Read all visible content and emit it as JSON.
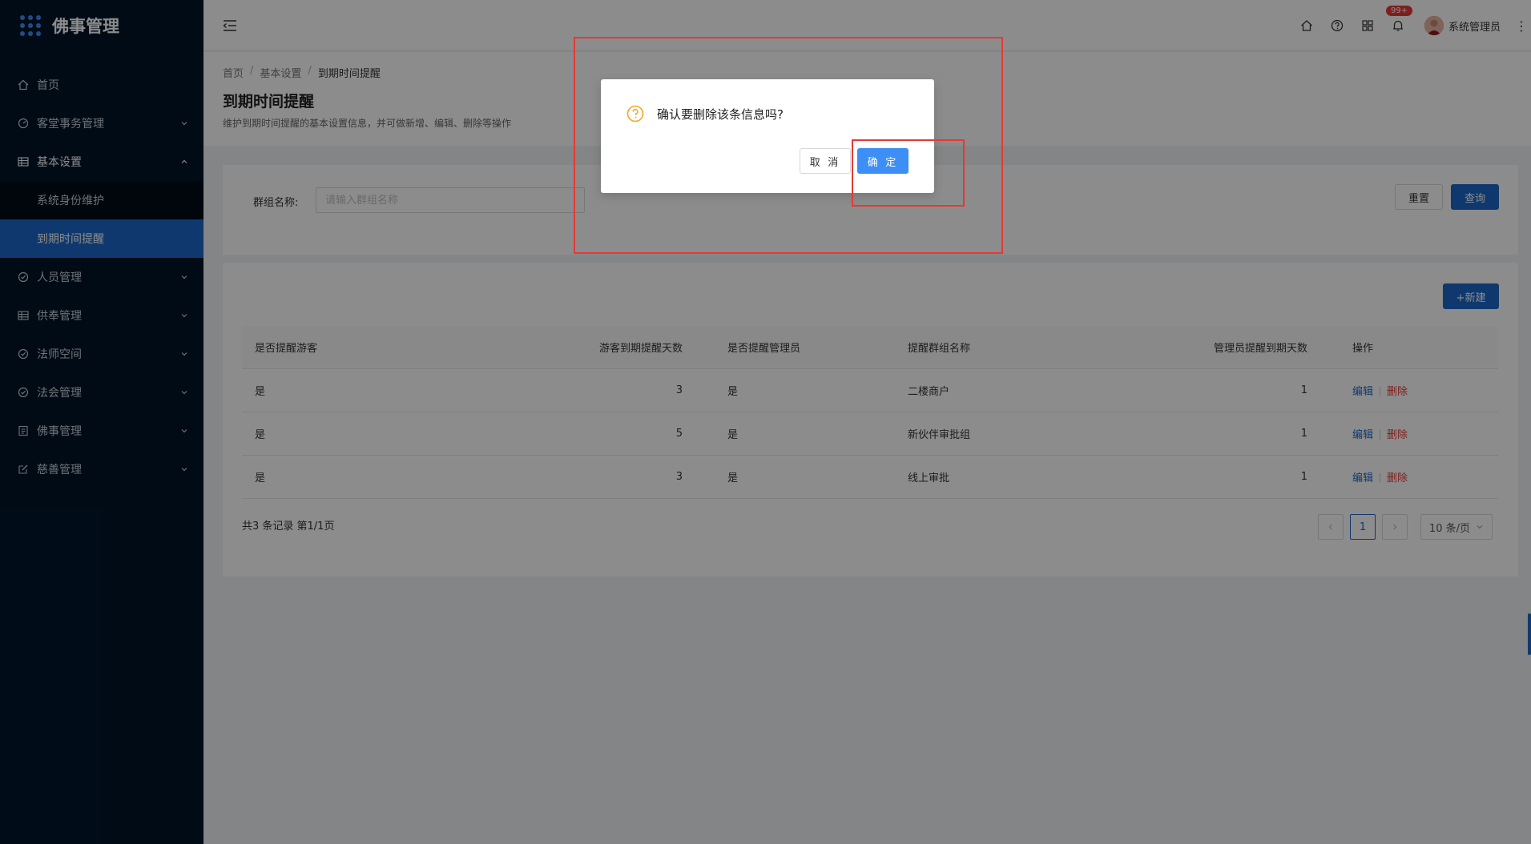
{
  "app": {
    "title": "佛事管理"
  },
  "sidebar": {
    "items": [
      {
        "label": "首页",
        "icon": "home-icon",
        "has_arrow": false
      },
      {
        "label": "客堂事务管理",
        "icon": "dashboard-icon",
        "has_arrow": true
      },
      {
        "label": "基本设置",
        "icon": "table-icon",
        "has_arrow": true,
        "expanded": true,
        "children": [
          {
            "label": "系统身份维护"
          },
          {
            "label": "到期时间提醒",
            "active": true
          }
        ]
      },
      {
        "label": "人员管理",
        "icon": "check-circle-icon",
        "has_arrow": true
      },
      {
        "label": "供奉管理",
        "icon": "table-icon",
        "has_arrow": true
      },
      {
        "label": "法师空间",
        "icon": "check-circle-icon",
        "has_arrow": true
      },
      {
        "label": "法会管理",
        "icon": "check-circle-icon",
        "has_arrow": true
      },
      {
        "label": "佛事管理",
        "icon": "profile-icon",
        "has_arrow": true
      },
      {
        "label": "慈善管理",
        "icon": "edit-icon",
        "has_arrow": true
      }
    ]
  },
  "header": {
    "notification_count": "99+",
    "username": "系统管理员"
  },
  "page": {
    "breadcrumb": [
      "首页",
      "基本设置",
      "到期时间提醒"
    ],
    "title": "到期时间提醒",
    "description": "维护到期时间提醒的基本设置信息，并可做新增、编辑、删除等操作"
  },
  "search": {
    "label": "群组名称:",
    "placeholder": "请输入群组名称",
    "value": "",
    "reset_label": "重置",
    "query_label": "查询"
  },
  "table": {
    "new_label": "+新建",
    "columns": [
      "是否提醒游客",
      "游客到期提醒天数",
      "是否提醒管理员",
      "提醒群组名称",
      "管理员提醒到期天数",
      "操作"
    ],
    "rows": [
      {
        "remind_visitor": "是",
        "visitor_days": "3",
        "remind_admin": "是",
        "group_name": "二楼商户",
        "admin_days": "1"
      },
      {
        "remind_visitor": "是",
        "visitor_days": "5",
        "remind_admin": "是",
        "group_name": "新伙伴审批组",
        "admin_days": "1"
      },
      {
        "remind_visitor": "是",
        "visitor_days": "3",
        "remind_admin": "是",
        "group_name": "线上审批",
        "admin_days": "1"
      }
    ],
    "edit_label": "编辑",
    "delete_label": "删除",
    "total_text": "共3 条记录 第1/1页",
    "current_page": "1",
    "page_size": "10 条/页"
  },
  "dialog": {
    "title": "确认要删除该条信息吗?",
    "cancel_label": "取 消",
    "ok_label": "确 定",
    "icon": "question-circle-icon"
  },
  "colors": {
    "sidebar_bg": "#001529",
    "primary": "#1c68c8",
    "danger": "#e53935",
    "annotation": "#e53935"
  }
}
